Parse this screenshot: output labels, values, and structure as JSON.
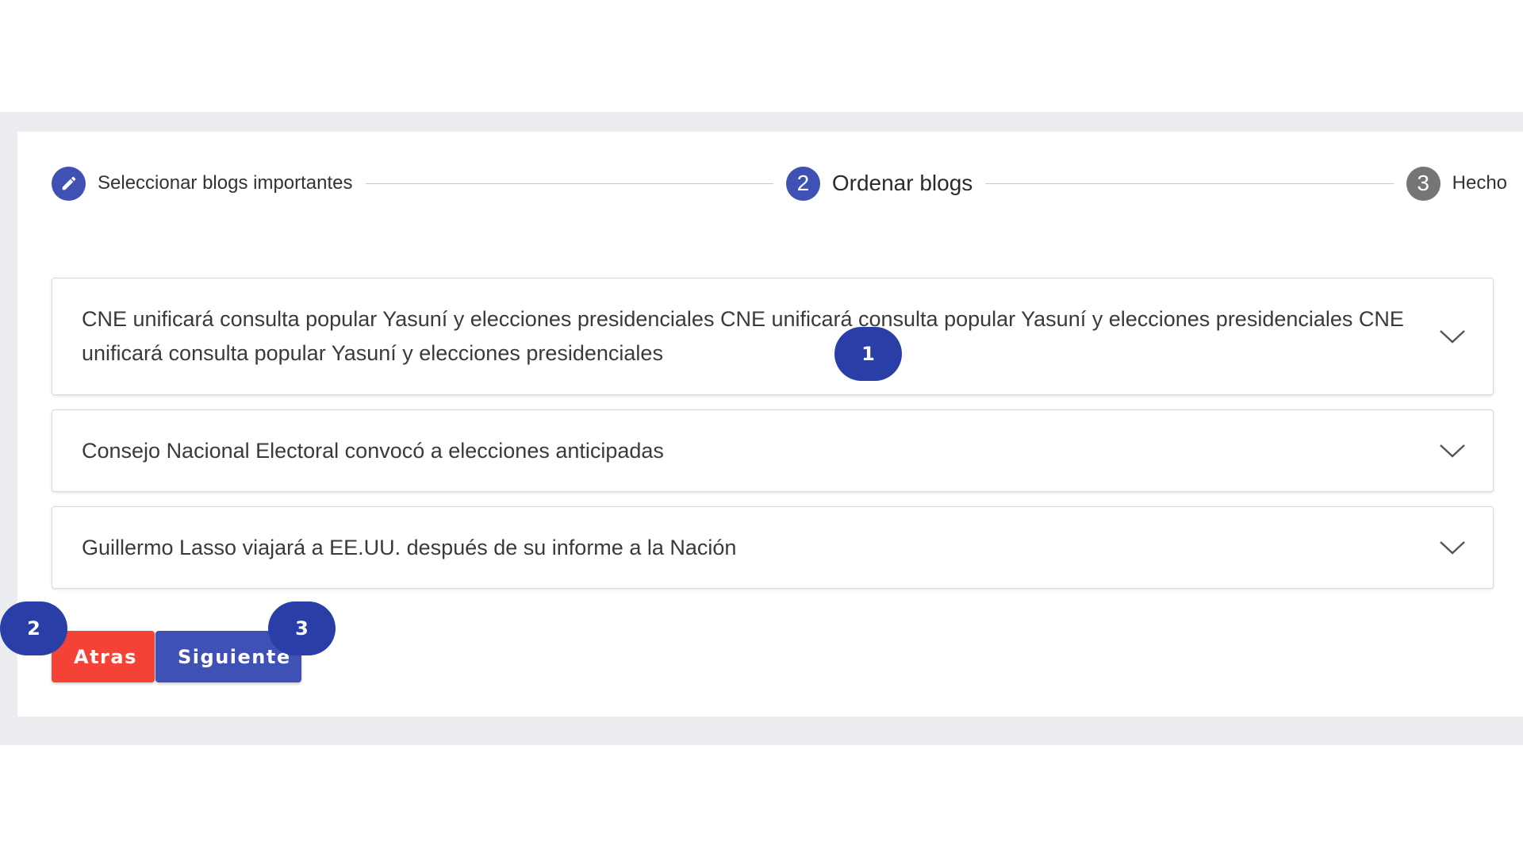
{
  "stepper": {
    "steps": [
      {
        "label": "Seleccionar blogs importantes",
        "number": ""
      },
      {
        "label": "Ordenar blogs",
        "number": "2"
      },
      {
        "label": "Hecho",
        "number": "3"
      }
    ]
  },
  "panels": [
    {
      "title": "CNE unificará consulta popular Yasuní y elecciones presidenciales CNE unificará consulta popular Yasuní y elecciones presidenciales CNE unificará consulta popular Yasuní y elecciones presidenciales"
    },
    {
      "title": "Consejo Nacional Electoral convocó a elecciones anticipadas"
    },
    {
      "title": "Guillermo Lasso viajará a EE.UU. después de su informe a la Nación"
    }
  ],
  "actions": {
    "back_label": "Atras",
    "next_label": "Siguiente"
  },
  "markers": [
    "1",
    "2",
    "3"
  ],
  "colors": {
    "primary": "#3f51b5",
    "danger": "#f44336",
    "marker": "#2a3ea8",
    "step_pending": "#757575"
  }
}
